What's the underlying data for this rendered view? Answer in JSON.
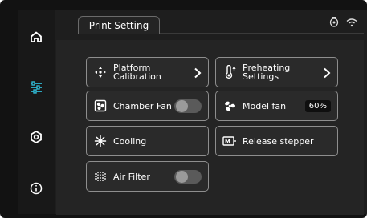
{
  "header": {
    "tab_label": "Print Setting"
  },
  "sidebar": {
    "items": [
      {
        "icon": "home-icon"
      },
      {
        "icon": "settings-sliders-icon",
        "active": true
      },
      {
        "icon": "gear-icon"
      },
      {
        "icon": "info-icon"
      }
    ]
  },
  "status_icons": [
    "camera-icon",
    "wifi-icon"
  ],
  "cards": {
    "platform_calibration": {
      "label": "Platform Calibration",
      "icon": "move-arrows-icon"
    },
    "preheating": {
      "label": "Preheating Settings",
      "icon": "thermometer-icon"
    },
    "chamber_fan": {
      "label": "Chamber Fan",
      "icon": "fan-box-icon",
      "toggle": "off"
    },
    "model_fan": {
      "label": "Model fan",
      "icon": "fan-icon",
      "value": "60%"
    },
    "cooling": {
      "label": "Cooling",
      "icon": "snowflake-icon"
    },
    "release_stepper": {
      "label": "Release stepper",
      "icon": "motor-icon"
    },
    "air_filter": {
      "label": "Air Filter",
      "icon": "air-filter-icon",
      "toggle": "off"
    }
  },
  "colors": {
    "accent": "#2fb7d2",
    "background": "#121212",
    "panel": "#242424",
    "card_border": "#8e8e8e"
  }
}
